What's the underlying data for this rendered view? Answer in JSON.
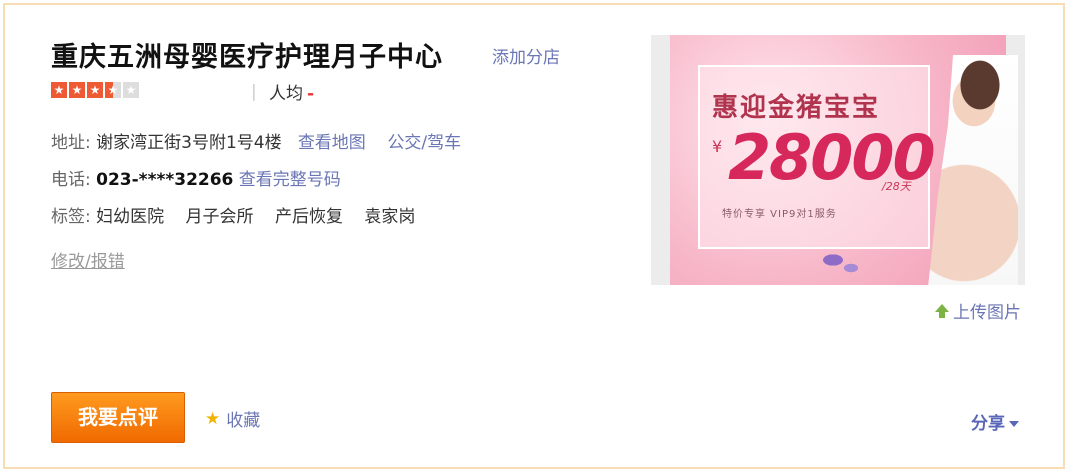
{
  "shop": {
    "name": "重庆五洲母婴医疗护理月子中心",
    "add_branch": "添加分店",
    "rating": 3.5,
    "rating_max": 5,
    "avg_label": "人均",
    "avg_value": "-"
  },
  "info": {
    "address_label": "地址:",
    "address": "谢家湾正街3号附1号4楼",
    "view_map": "查看地图",
    "transit": "公交/驾车",
    "phone_label": "电话:",
    "phone": "023-****32266",
    "view_phone": "查看完整号码",
    "tags_label": "标签:",
    "tags": [
      "妇幼医院",
      "月子会所",
      "产后恢复",
      "袁家岗"
    ]
  },
  "correct_link": "修改/报错",
  "poster": {
    "headline": "惠迎金猪宝宝",
    "currency": "¥",
    "price": "28000",
    "unit": "/28天",
    "subline": "特价专享 VIP9对1服务"
  },
  "upload_label": "上传图片",
  "review_button": "我要点评",
  "favorite_label": "收藏",
  "share_label": "分享",
  "colors": {
    "accent_orange": "#f07b0a",
    "link_blue": "#6b76b5",
    "star_red": "#ee5a33",
    "border": "#f7dcb4"
  }
}
